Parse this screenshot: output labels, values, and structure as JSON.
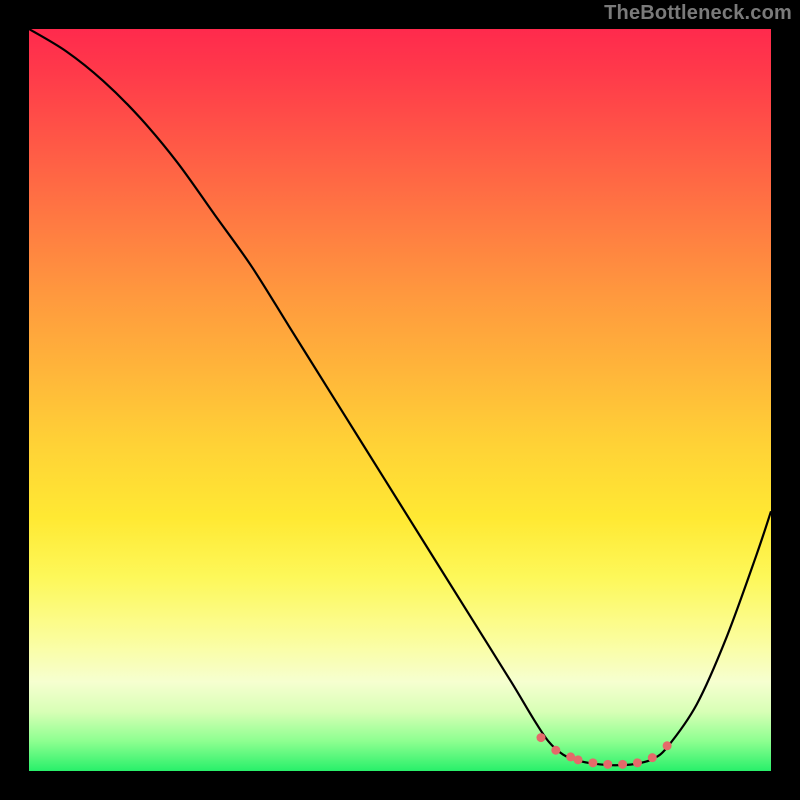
{
  "watermark": "TheBottleneck.com",
  "chart_data": {
    "type": "line",
    "title": "",
    "xlabel": "",
    "ylabel": "",
    "xlim": [
      0,
      100
    ],
    "ylim": [
      0,
      100
    ],
    "series": [
      {
        "name": "curve",
        "x": [
          0,
          5,
          10,
          15,
          20,
          25,
          30,
          35,
          40,
          45,
          50,
          55,
          60,
          65,
          68,
          70,
          72,
          74,
          76,
          78,
          80,
          82,
          84,
          86,
          90,
          94,
          98,
          100
        ],
        "values": [
          100,
          97,
          93,
          88,
          82,
          75,
          68,
          60,
          52,
          44,
          36,
          28,
          20,
          12,
          7,
          4,
          2.2,
          1.4,
          1.0,
          0.8,
          0.8,
          1.0,
          1.6,
          3.2,
          9,
          18,
          29,
          35
        ]
      },
      {
        "name": "markers",
        "x": [
          69,
          71,
          73,
          74,
          76,
          78,
          80,
          82,
          84,
          86
        ],
        "values": [
          4.5,
          2.8,
          1.9,
          1.5,
          1.1,
          0.9,
          0.9,
          1.1,
          1.8,
          3.4
        ]
      }
    ],
    "marker_color": "#e46a6a",
    "curve_color": "#000000"
  }
}
